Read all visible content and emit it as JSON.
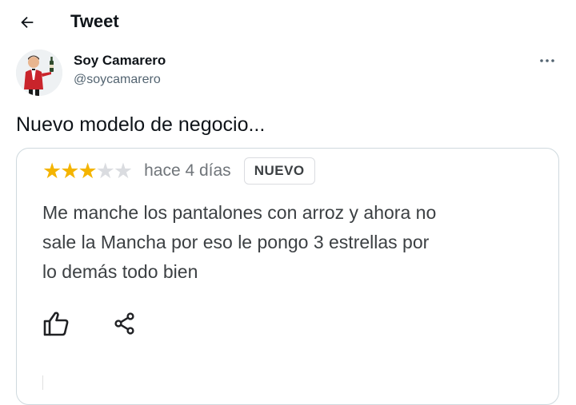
{
  "header": {
    "title": "Tweet",
    "back_icon": "arrow-left-icon"
  },
  "author": {
    "display_name": "Soy Camarero",
    "handle": "@soycamarero",
    "avatar_icon": "waiter-avatar",
    "more_icon": "more-dots-icon"
  },
  "tweet": {
    "text": "Nuevo modelo de negocio..."
  },
  "review": {
    "rating": 3,
    "max_rating": 5,
    "date": "hace 4 días",
    "badge": "NUEVO",
    "body_lines": [
      "Me manche los pantalones con arroz y ahora no",
      "sale la Mancha por eso le pongo 3 estrellas por",
      "lo demás todo bien"
    ],
    "like_icon": "thumbs-up-icon",
    "share_icon": "share-icon"
  },
  "colors": {
    "star_filled": "#f4b400",
    "star_empty": "#dadce0",
    "secondary_text": "#536471"
  }
}
